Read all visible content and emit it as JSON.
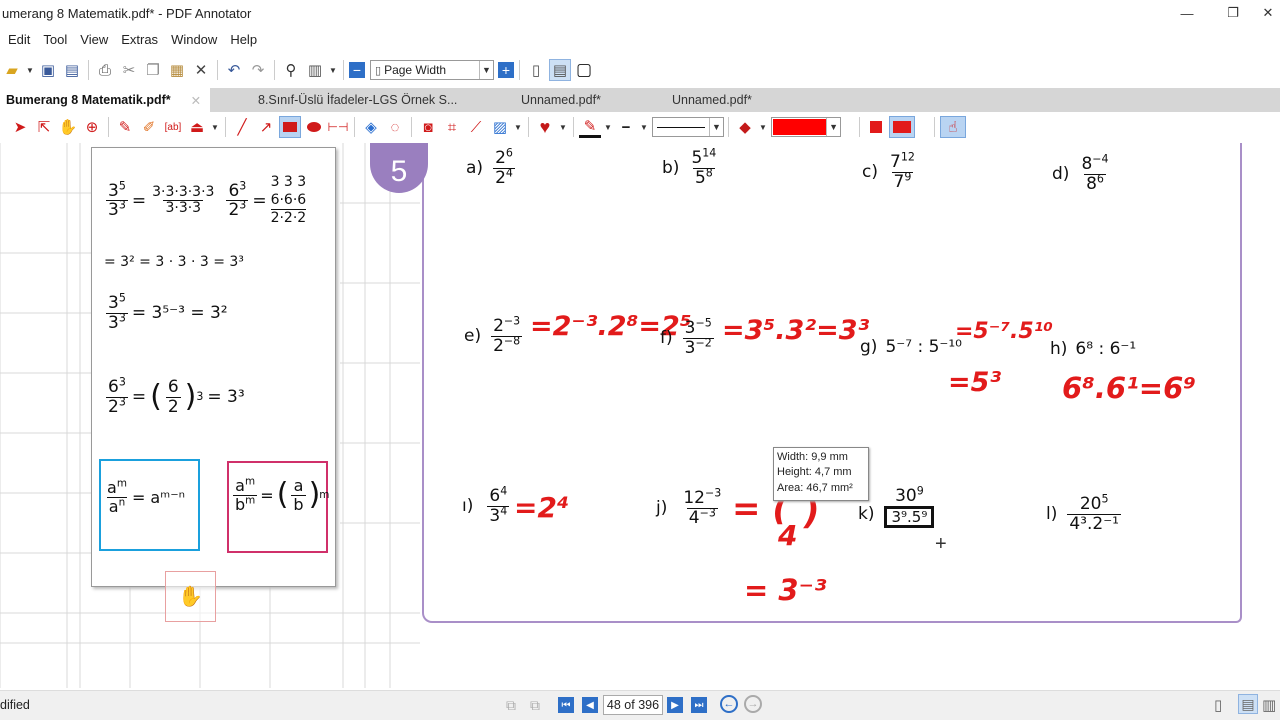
{
  "window": {
    "title": "umerang 8 Matematik.pdf* - PDF Annotator",
    "min": "—",
    "max": "❐",
    "close": "✕"
  },
  "menu": [
    "Edit",
    "Tool",
    "View",
    "Extras",
    "Window",
    "Help"
  ],
  "toolbar": {
    "zoom_mode": "Page Width"
  },
  "tabs": [
    {
      "label": "Bumerang 8 Matematik.pdf*"
    },
    {
      "label": "8.Sınıf-Üslü İfadeler-LGS Örnek S..."
    },
    {
      "label": "Unnamed.pdf*"
    },
    {
      "label": "Unnamed.pdf*"
    }
  ],
  "colors": {
    "annotation_red": "#e21b1b",
    "tab_active": "#ffffff",
    "highlight": "#ff0000"
  },
  "left_page": {
    "ex1_num1": "3",
    "ex1_pow": "5",
    "ex1_den": "3",
    "ex1_dpow": "3",
    "ex1_expand_num": "3·3·3·3·3",
    "ex1_expand_den": "3·3·3",
    "ex2_num": "6",
    "ex2_pow": "3",
    "ex2_den": "2",
    "ex2_dpow": "3",
    "ex2_top": "3 3 3",
    "ex2_mid": "6·6·6",
    "ex2_bot": "2·2·2",
    "line2": "= 3² = 3 · 3 · 3 = 3³",
    "rule1": "= 3⁵⁻³ = 3²",
    "rule2": "= 3³",
    "box1": "= aᵐ⁻ⁿ",
    "box2_eq": "="
  },
  "badge": "5",
  "problems": {
    "a": {
      "label": "a)",
      "num": "2",
      "numpow": "6",
      "den": "2",
      "denpow": "4"
    },
    "b": {
      "label": "b)",
      "num": "5",
      "numpow": "14",
      "den": "5",
      "denpow": "8"
    },
    "c": {
      "label": "c)",
      "num": "7",
      "numpow": "12",
      "den": "7",
      "denpow": "9"
    },
    "d": {
      "label": "d)",
      "num": "8",
      "numpow": "−4",
      "den": "8",
      "denpow": "6"
    },
    "e": {
      "label": "e)",
      "num": "2",
      "numpow": "−3",
      "den": "2",
      "denpow": "−8"
    },
    "f": {
      "label": "f)",
      "num": "3",
      "numpow": "−5",
      "den": "3",
      "denpow": "−2"
    },
    "g": {
      "label": "g)",
      "text": "5⁻⁷ : 5⁻¹⁰"
    },
    "h": {
      "label": "h)",
      "text": "6⁸ : 6⁻¹"
    },
    "i": {
      "label": "ı)",
      "num": "6",
      "numpow": "4",
      "den": "3",
      "denpow": "4"
    },
    "j": {
      "label": "j)",
      "num": "12",
      "numpow": "−3",
      "den": "4",
      "denpow": "−3"
    },
    "k": {
      "label": "k)",
      "num": "30",
      "numpow": "9",
      "den": "3⁹.5⁹"
    },
    "l": {
      "label": "l)",
      "num": "20",
      "numpow": "5",
      "den": "4³.2⁻¹"
    }
  },
  "annotations": {
    "e": "=2⁻³.2⁸=2⁵",
    "f": "=3⁵.3²=3³",
    "g1": "=5⁻⁷.5¹⁰",
    "g2": "=5³",
    "h": "6⁸.6¹=6⁹",
    "i": "=2⁴",
    "j1": "= (",
    "j2": "4",
    "j3": ")",
    "j4": "= 3⁻³"
  },
  "tooltip": {
    "width": "Width: 9,9 mm",
    "height": "Height:  4,7 mm",
    "area": "Area: 46,7 mm²"
  },
  "status": {
    "left": "dified",
    "page": "48 of 396"
  }
}
